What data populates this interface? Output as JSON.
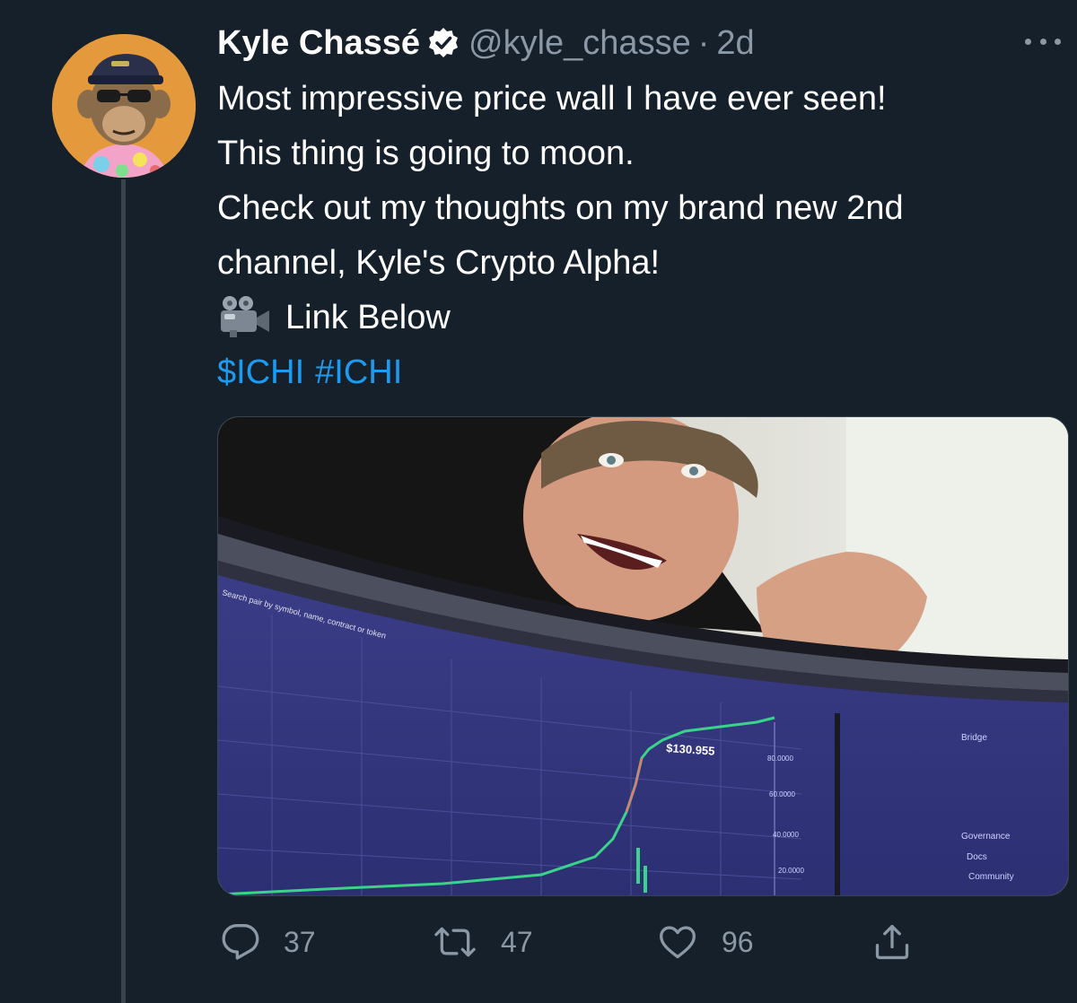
{
  "tweet": {
    "author_name": "Kyle Chassé",
    "handle": "@kyle_chasse",
    "separator": "·",
    "time": "2d",
    "lines": [
      "Most impressive price wall I have ever seen!",
      "This thing is going to moon.",
      "Check out my thoughts on my brand new 2nd",
      "channel, Kyle's Crypto Alpha!"
    ],
    "link_line": "Link Below",
    "link_icon": "movie-camera-icon",
    "hashtags": [
      "$ICHI",
      "#ICHI"
    ],
    "media": {
      "screen_price": "$130.955",
      "screen_axis_labels": [
        "80.0000",
        "60.0000",
        "40.0000",
        "20.0000"
      ],
      "screen_sidebar_items": [
        "Bridge",
        "Governance",
        "Docs",
        "Community"
      ],
      "search_placeholder": "Search pair by symbol, name, contract or token"
    },
    "actions": {
      "reply_count": "37",
      "retweet_count": "47",
      "like_count": "96"
    }
  },
  "colors": {
    "background": "#15202b",
    "secondary_text": "#8b98a5",
    "link": "#1d9bf0",
    "avatar_bg": "#e49a3c"
  }
}
